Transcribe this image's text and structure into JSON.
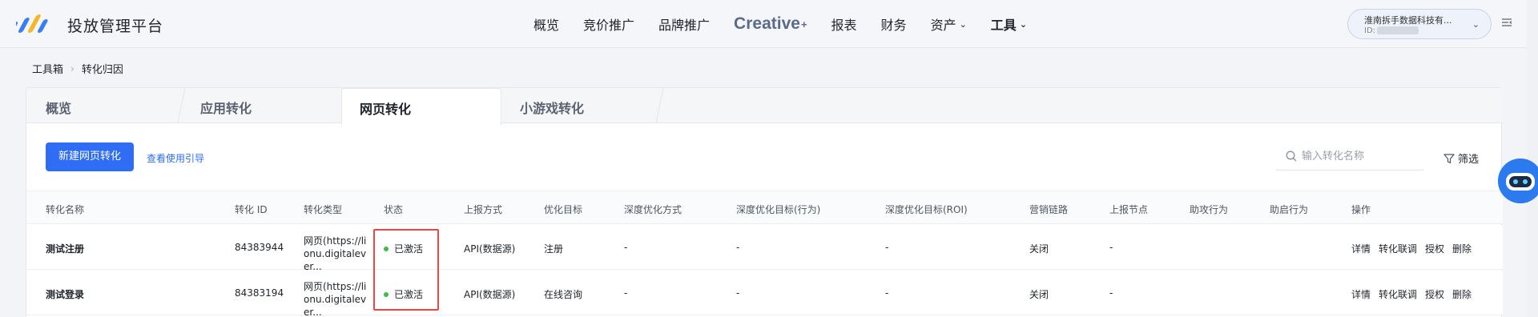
{
  "header": {
    "platform_name": "投放管理平台",
    "nav": [
      {
        "label": "概览"
      },
      {
        "label": "竞价推广"
      },
      {
        "label": "品牌推广"
      },
      {
        "label": "Creative"
      },
      {
        "label": "报表"
      },
      {
        "label": "财务"
      },
      {
        "label": "资产"
      },
      {
        "label": "工具"
      }
    ],
    "brand_plus": "+",
    "account": {
      "name": "淮南拆手数据科技有...",
      "id_prefix": "ID:"
    }
  },
  "breadcrumb": [
    "工具箱",
    "转化归因"
  ],
  "tabs": [
    {
      "label": "概览"
    },
    {
      "label": "应用转化"
    },
    {
      "label": "网页转化",
      "active": true
    },
    {
      "label": "小游戏转化"
    }
  ],
  "toolbar": {
    "new_button": "新建网页转化",
    "guide_link": "查看使用引导",
    "search_placeholder": "输入转化名称",
    "filter_label": "筛选"
  },
  "table": {
    "columns": [
      "转化名称",
      "转化 ID",
      "转化类型",
      "状态",
      "上报方式",
      "优化目标",
      "深度优化方式",
      "深度优化目标(行为)",
      "深度优化目标(ROI)",
      "营销链路",
      "上报节点",
      "助攻行为",
      "助启行为",
      "操作"
    ],
    "rows": [
      {
        "name": "测试注册",
        "id": "84383944",
        "type": "网页(https://lionu.digitalever...",
        "status": "已激活",
        "report": "API(数据源)",
        "goal": "注册",
        "deep_method": "-",
        "deep_action": "-",
        "deep_roi": "-",
        "chain": "关闭",
        "node": "-"
      },
      {
        "name": "测试登录",
        "id": "84383194",
        "type": "网页(https://lionu.digitalever...",
        "status": "已激活",
        "report": "API(数据源)",
        "goal": "在线咨询",
        "deep_method": "-",
        "deep_action": "-",
        "deep_roi": "-",
        "chain": "关闭",
        "node": "-"
      }
    ],
    "actions": [
      "详情",
      "转化联调",
      "授权",
      "删除"
    ]
  },
  "colors": {
    "primary": "#2f6df5",
    "status_active": "#3cba4c",
    "highlight": "#e84545"
  }
}
